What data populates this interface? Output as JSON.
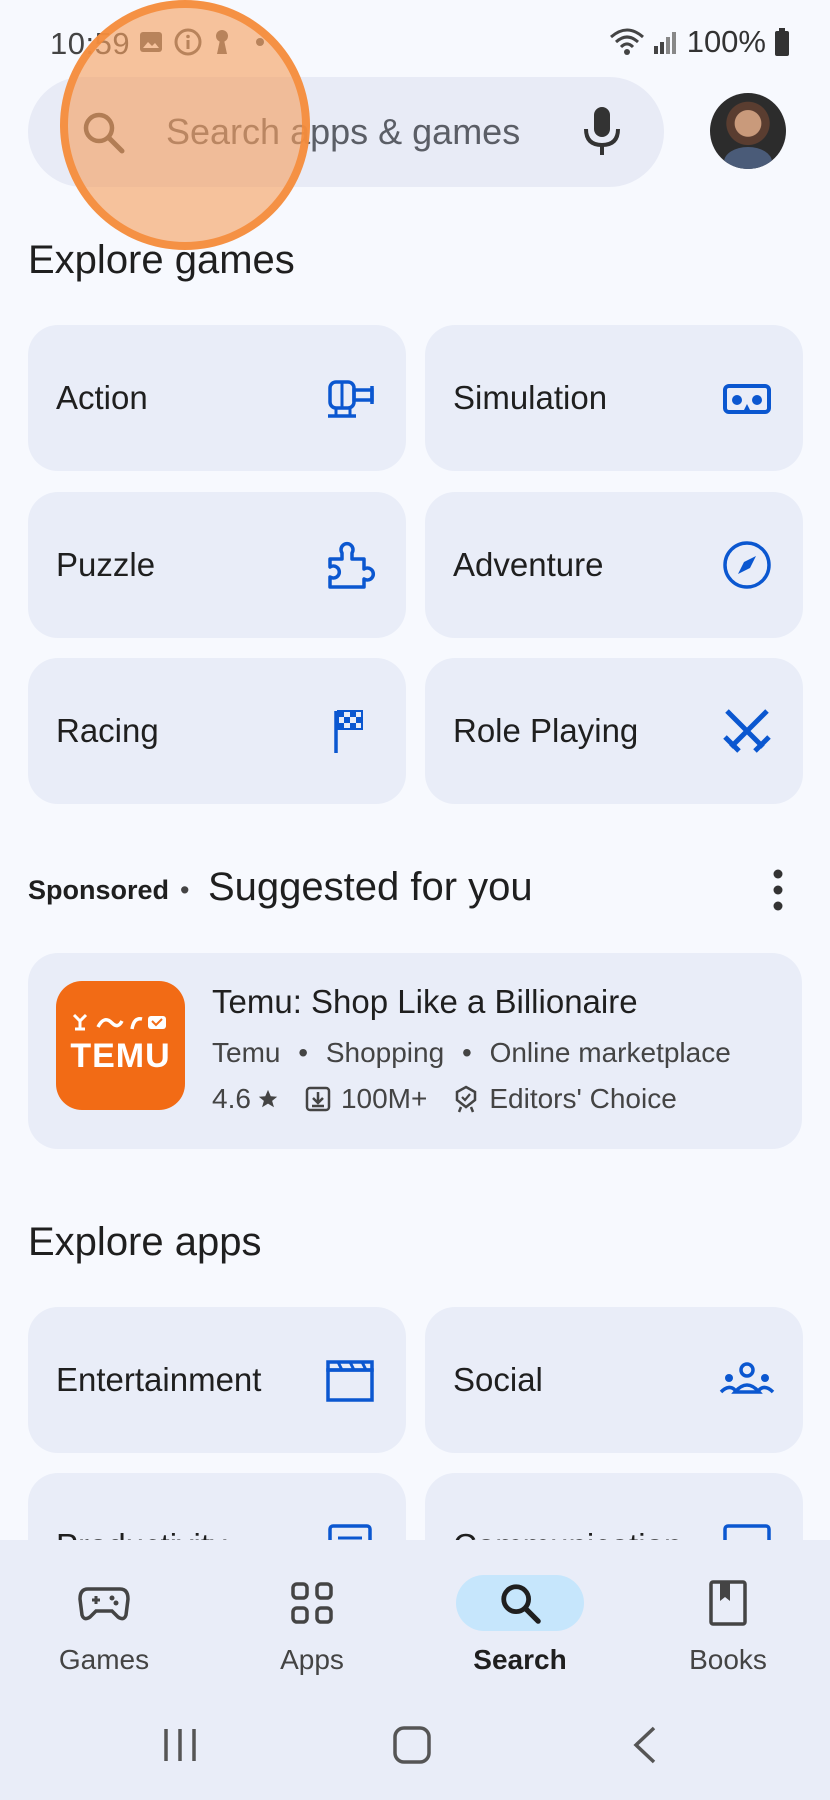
{
  "status_bar": {
    "time": "10:59",
    "battery": "100%"
  },
  "search": {
    "placeholder": "Search apps & games"
  },
  "explore_games": {
    "title": "Explore games",
    "tiles": [
      {
        "label": "Action",
        "icon": "helicopter-icon"
      },
      {
        "label": "Simulation",
        "icon": "vr-headset-icon"
      },
      {
        "label": "Puzzle",
        "icon": "puzzle-icon"
      },
      {
        "label": "Adventure",
        "icon": "compass-icon"
      },
      {
        "label": "Racing",
        "icon": "checkered-flag-icon"
      },
      {
        "label": "Role Playing",
        "icon": "crossed-swords-icon"
      }
    ]
  },
  "suggested": {
    "sponsored_label": "Sponsored",
    "separator": "•",
    "title": "Suggested for you",
    "app": {
      "name": "Temu: Shop Like a Billionaire",
      "developer": "Temu",
      "category": "Shopping",
      "tag": "Online marketplace",
      "rating": "4.6",
      "downloads": "100M+",
      "badge": "Editors' Choice",
      "logo_text": "TEMU"
    }
  },
  "explore_apps": {
    "title": "Explore apps",
    "tiles": [
      {
        "label": "Entertainment",
        "icon": "clapperboard-icon"
      },
      {
        "label": "Social",
        "icon": "people-icon"
      },
      {
        "label": "Productivity",
        "icon": "list-icon"
      },
      {
        "label": "Communication",
        "icon": "chat-icon"
      }
    ]
  },
  "bottom_nav": {
    "items": [
      {
        "label": "Games",
        "icon": "gamepad-icon"
      },
      {
        "label": "Apps",
        "icon": "apps-grid-icon"
      },
      {
        "label": "Search",
        "icon": "search-icon",
        "active": true
      },
      {
        "label": "Books",
        "icon": "book-icon"
      }
    ]
  },
  "colors": {
    "accent": "#0b57d0",
    "tile_bg": "#e9edf8",
    "active_pill": "#c6e6fc",
    "temu_orange": "#f26b15"
  }
}
